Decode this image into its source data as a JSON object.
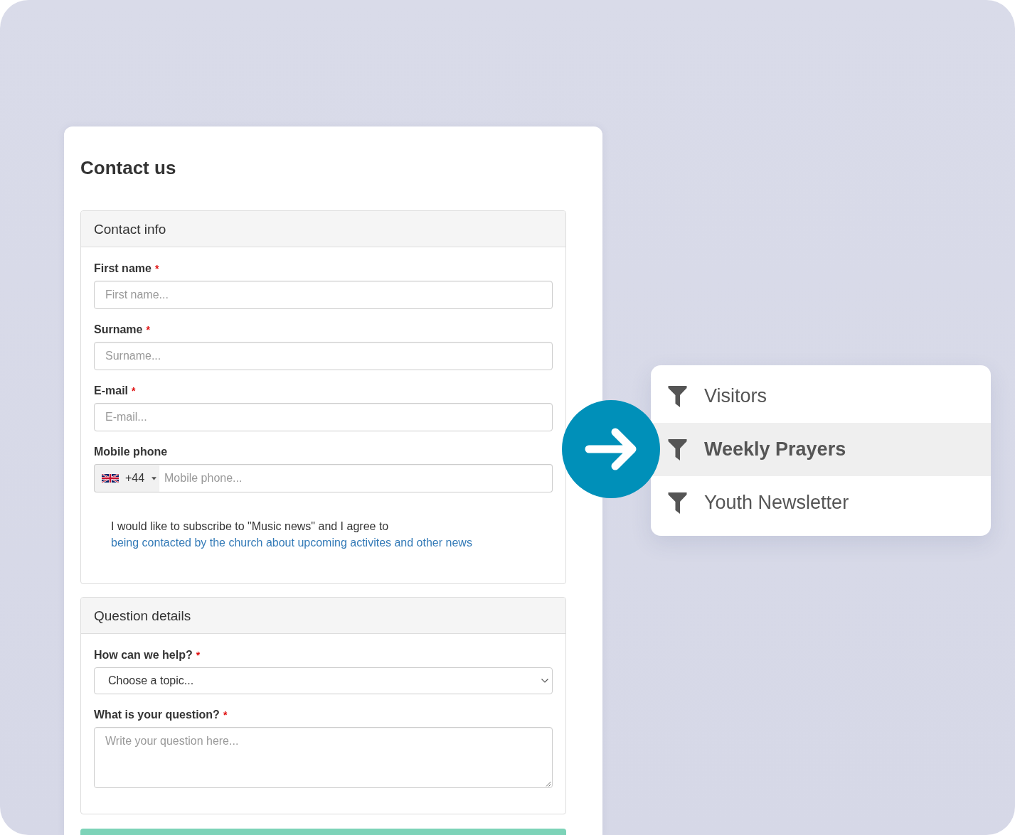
{
  "title": "Contact us",
  "sections": [
    {
      "heading": "Contact info",
      "fields": [
        {
          "kind": "text",
          "label": "First name",
          "marker": "*",
          "placeholder": "First name..."
        },
        {
          "kind": "text",
          "label": "Surname",
          "marker": "*",
          "placeholder": "Surname..."
        },
        {
          "kind": "text",
          "label": "E-mail",
          "marker": "*",
          "placeholder": "E-mail..."
        },
        {
          "kind": "phone",
          "label": "Mobile phone",
          "country_code": "+44",
          "placeholder": "Mobile phone..."
        },
        {
          "kind": "consent",
          "text": "I would like to subscribe to \"Music news\" and I agree to",
          "link": "being contacted by the church about upcoming activites and other news"
        }
      ]
    },
    {
      "heading": "Question details",
      "fields": [
        {
          "kind": "select",
          "label": "How can we help?",
          "marker": "*",
          "value": "Choose a topic..."
        },
        {
          "kind": "textarea",
          "label": "What is your question?",
          "marker": "*",
          "placeholder": "Write your question here..."
        }
      ]
    }
  ],
  "menu": {
    "items": [
      {
        "label": "Visitors",
        "selected": false
      },
      {
        "label": "Weekly Prayers",
        "selected": true
      },
      {
        "label": "Youth Newsletter",
        "selected": false
      }
    ]
  }
}
